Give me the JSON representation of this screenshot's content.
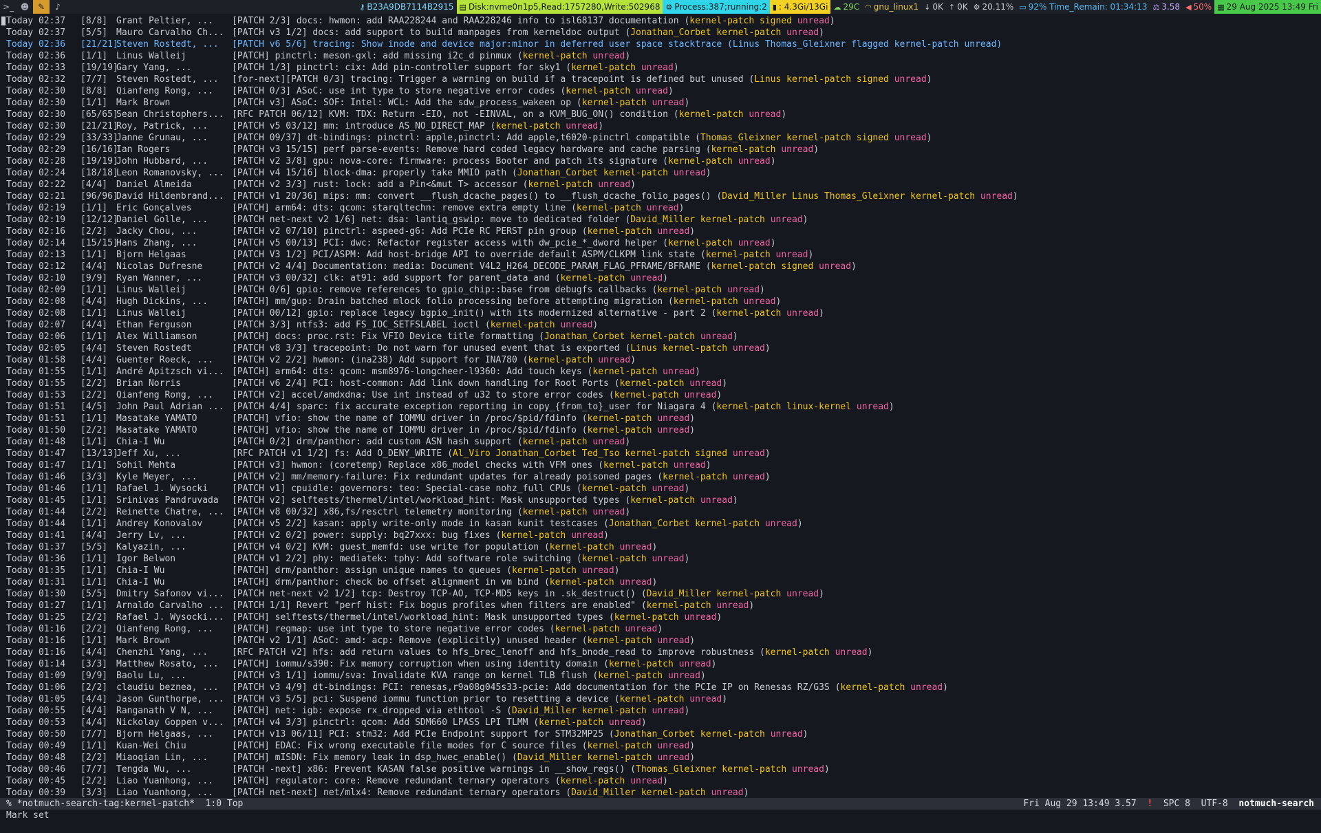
{
  "topbar": {
    "workspaces": [
      ">_",
      "☻",
      "✎",
      "♪"
    ],
    "ip": "B23A9DB7114B2915",
    "disk": "Disk:nvme0n1p5,Read:1757280,Write:502968",
    "process": "Process:387;running:2",
    "mem": ": 4.3Gi/13Gi",
    "temp": "29C",
    "wifi": "gnu_linux1",
    "down": "0K",
    "up": "0K",
    "cpu": "20.11%",
    "battery": "92%",
    "time_remain": "Time_Remain: 01:34:13",
    "load": "3.58",
    "volume": "50%",
    "date": "29 Aug 2025 13:49 Fri",
    "colors": {
      "disk": "#b5e33a",
      "process": "#2fd5e8",
      "mem": "#f2d024",
      "date": "#49c94a"
    }
  },
  "threads": [
    {
      "date": "Today 02:37",
      "count": "[8/8]",
      "author": "Grant Peltier, ...",
      "subject": "[PATCH 2/3] docs: hwmon: add RAA228244 and RAA228246 info to isl68137 documentation",
      "tags": "kernel-patch signed"
    },
    {
      "date": "Today 02:37",
      "count": "[5/5]",
      "author": "Mauro Carvalho Ch...",
      "subject": "[PATCH v3 1/2] docs: add support to build manpages from kerneldoc output",
      "tags": "Jonathan_Corbet kernel-patch"
    },
    {
      "date": "Today 02:36",
      "count": "[21/21]",
      "author": "Steven Rostedt, ...",
      "subject": "[PATCH v6 5/6] tracing: Show inode and device major:minor in deferred user space stacktrace",
      "tags": "Linus Thomas_Gleixner flagged kernel-patch",
      "selected": true
    },
    {
      "date": "Today 02:36",
      "count": "[1/1]",
      "author": "Linus Walleij",
      "subject": "[PATCH] pinctrl: meson-gxl: add missing i2c_d pinmux",
      "tags": "kernel-patch"
    },
    {
      "date": "Today 02:33",
      "count": "[19/19]",
      "author": "Gary Yang, ...",
      "subject": "[PATCH 1/3] pinctrl: cix: Add pin-controller support for sky1",
      "tags": "kernel-patch"
    },
    {
      "date": "Today 02:32",
      "count": "[7/7]",
      "author": "Steven Rostedt, ...",
      "subject": "[for-next][PATCH 0/3] tracing: Trigger a warning on build if a tracepoint is defined but unused",
      "tags": "Linus kernel-patch signed"
    },
    {
      "date": "Today 02:30",
      "count": "[8/8]",
      "author": "Qianfeng Rong, ...",
      "subject": "[PATCH 0/3] ASoC: use int type to store negative error codes",
      "tags": "kernel-patch"
    },
    {
      "date": "Today 02:30",
      "count": "[1/1]",
      "author": "Mark Brown",
      "subject": "[PATCH v3] ASoC: SOF: Intel: WCL: Add the sdw_process_wakeen op",
      "tags": "kernel-patch"
    },
    {
      "date": "Today 02:30",
      "count": "[65/65]",
      "author": "Sean Christophers...",
      "subject": "[RFC PATCH 06/12] KVM: TDX: Return -EIO, not -EINVAL, on a KVM_BUG_ON() condition",
      "tags": "kernel-patch"
    },
    {
      "date": "Today 02:30",
      "count": "[21/21]",
      "author": "Roy, Patrick, ...",
      "subject": "[PATCH v5 03/12] mm: introduce AS_NO_DIRECT_MAP",
      "tags": "kernel-patch"
    },
    {
      "date": "Today 02:29",
      "count": "[33/33]",
      "author": "Janne Grunau, ...",
      "subject": "[PATCH 09/37] dt-bindings: pinctrl: apple,pinctrl: Add apple,t6020-pinctrl compatible",
      "tags": "Thomas_Gleixner kernel-patch signed"
    },
    {
      "date": "Today 02:29",
      "count": "[16/16]",
      "author": "Ian Rogers",
      "subject": "[PATCH v3 15/15] perf parse-events: Remove hard coded legacy hardware and cache parsing",
      "tags": "kernel-patch"
    },
    {
      "date": "Today 02:28",
      "count": "[19/19]",
      "author": "John Hubbard, ...",
      "subject": "[PATCH v2 3/8] gpu: nova-core: firmware: process Booter and patch its signature",
      "tags": "kernel-patch"
    },
    {
      "date": "Today 02:24",
      "count": "[18/18]",
      "author": "Leon Romanovsky, ...",
      "subject": "[PATCH v4 15/16] block-dma: properly take MMIO path",
      "tags": "Jonathan_Corbet kernel-patch"
    },
    {
      "date": "Today 02:22",
      "count": "[4/4]",
      "author": "Daniel Almeida",
      "subject": "[PATCH v2 3/3] rust: lock: add a Pin<&mut T> accessor",
      "tags": "kernel-patch"
    },
    {
      "date": "Today 02:21",
      "count": "[96/96]",
      "author": "David Hildenbrand...",
      "subject": "[PATCH v1 20/36] mips: mm: convert __flush_dcache_pages() to __flush_dcache_folio_pages()",
      "tags": "David_Miller Linus Thomas_Gleixner kernel-patch"
    },
    {
      "date": "Today 02:19",
      "count": "[1/1]",
      "author": "Eric Gonçalves",
      "subject": "[PATCH] arm64: dts: qcom: starqltechn: remove extra empty line",
      "tags": "kernel-patch"
    },
    {
      "date": "Today 02:19",
      "count": "[12/12]",
      "author": "Daniel Golle, ...",
      "subject": "[PATCH net-next v2 1/6] net: dsa: lantiq_gswip: move to dedicated folder",
      "tags": "David_Miller kernel-patch"
    },
    {
      "date": "Today 02:16",
      "count": "[2/2]",
      "author": "Jacky Chou, ...",
      "subject": "[PATCH v2 07/10] pinctrl: aspeed-g6: Add PCIe RC PERST pin group",
      "tags": "kernel-patch"
    },
    {
      "date": "Today 02:14",
      "count": "[15/15]",
      "author": "Hans Zhang, ...",
      "subject": "[PATCH v5 00/13] PCI: dwc: Refactor register access with dw_pcie_*_dword helper",
      "tags": "kernel-patch"
    },
    {
      "date": "Today 02:13",
      "count": "[1/1]",
      "author": "Bjorn Helgaas",
      "subject": "[PATCH V3 1/2] PCI/ASPM: Add host-bridge API to override default ASPM/CLKPM link state",
      "tags": "kernel-patch"
    },
    {
      "date": "Today 02:12",
      "count": "[4/4]",
      "author": "Nicolas Dufresne",
      "subject": "[PATCH v2 4/4] Documentation: media: Document V4L2_H264_DECODE_PARAM_FLAG_PFRAME/BFRAME",
      "tags": "kernel-patch signed"
    },
    {
      "date": "Today 02:10",
      "count": "[9/9]",
      "author": "Ryan Wanner, ...",
      "subject": "[PATCH v3 00/32] clk: at91: add support for parent_data and",
      "tags": "kernel-patch"
    },
    {
      "date": "Today 02:09",
      "count": "[1/1]",
      "author": "Linus Walleij",
      "subject": "[PATCH 0/6] gpio: remove references to gpio_chip::base from debugfs callbacks",
      "tags": "kernel-patch"
    },
    {
      "date": "Today 02:08",
      "count": "[4/4]",
      "author": "Hugh Dickins, ...",
      "subject": "[PATCH] mm/gup: Drain batched mlock folio processing before attempting migration",
      "tags": "kernel-patch"
    },
    {
      "date": "Today 02:08",
      "count": "[1/1]",
      "author": "Linus Walleij",
      "subject": "[PATCH 00/12] gpio: replace legacy bgpio_init() with its modernized alternative - part 2",
      "tags": "kernel-patch"
    },
    {
      "date": "Today 02:07",
      "count": "[4/4]",
      "author": "Ethan Ferguson",
      "subject": "[PATCH 3/3] ntfs3: add FS_IOC_SETFSLABEL ioctl",
      "tags": "kernel-patch"
    },
    {
      "date": "Today 02:06",
      "count": "[1/1]",
      "author": "Alex Williamson",
      "subject": "[PATCH] docs: proc.rst: Fix VFIO Device title formatting",
      "tags": "Jonathan_Corbet kernel-patch"
    },
    {
      "date": "Today 02:05",
      "count": "[4/4]",
      "author": "Steven Rostedt",
      "subject": "[PATCH v8 3/3] tracepoint: Do not warn for unused event that is exported",
      "tags": "Linus kernel-patch"
    },
    {
      "date": "Today 01:58",
      "count": "[4/4]",
      "author": "Guenter Roeck, ...",
      "subject": "[PATCH v2 2/2] hwmon: (ina238) Add support for INA780",
      "tags": "kernel-patch"
    },
    {
      "date": "Today 01:55",
      "count": "[1/1]",
      "author": "André Apitzsch vi...",
      "subject": "[PATCH] arm64: dts: qcom: msm8976-longcheer-l9360: Add touch keys",
      "tags": "kernel-patch"
    },
    {
      "date": "Today 01:55",
      "count": "[2/2]",
      "author": "Brian Norris",
      "subject": "[PATCH v6 2/4] PCI: host-common: Add link down handling for Root Ports",
      "tags": "kernel-patch"
    },
    {
      "date": "Today 01:53",
      "count": "[2/2]",
      "author": "Qianfeng Rong, ...",
      "subject": "[PATCH v2] accel/amdxdna: Use int instead of u32 to store error codes",
      "tags": "kernel-patch"
    },
    {
      "date": "Today 01:51",
      "count": "[4/5]",
      "author": "John Paul Adrian ...",
      "subject": "[PATCH 4/4] sparc: fix accurate exception reporting in copy_{from_to}_user for Niagara 4",
      "tags": "kernel-patch linux-kernel"
    },
    {
      "date": "Today 01:51",
      "count": "[1/1]",
      "author": "Masatake YAMATO",
      "subject": "[PATCH] vfio: show the name of IOMMU driver in /proc/$pid/fdinfo",
      "tags": "kernel-patch"
    },
    {
      "date": "Today 01:50",
      "count": "[2/2]",
      "author": "Masatake YAMATO",
      "subject": "[PATCH] vfio: show the name of IOMMU driver in /proc/$pid/fdinfo",
      "tags": "kernel-patch"
    },
    {
      "date": "Today 01:48",
      "count": "[1/1]",
      "author": "Chia-I Wu",
      "subject": "[PATCH 0/2] drm/panthor: add custom ASN hash support",
      "tags": "kernel-patch"
    },
    {
      "date": "Today 01:47",
      "count": "[13/13]",
      "author": "Jeff Xu, ...",
      "subject": "[RFC PATCH v1 1/2] fs: Add O_DENY_WRITE",
      "tags": "Al_Viro Jonathan_Corbet Ted_Tso kernel-patch signed"
    },
    {
      "date": "Today 01:47",
      "count": "[1/1]",
      "author": "Sohil Mehta",
      "subject": "[PATCH v3] hwmon: (coretemp) Replace x86_model checks with VFM ones",
      "tags": "kernel-patch"
    },
    {
      "date": "Today 01:46",
      "count": "[3/3]",
      "author": "Kyle Meyer, ...",
      "subject": "[PATCH v2] mm/memory-failure: Fix redundant updates for already poisoned pages",
      "tags": "kernel-patch"
    },
    {
      "date": "Today 01:46",
      "count": "[1/1]",
      "author": "Rafael J. Wysocki",
      "subject": "[PATCH v1] cpuidle: governors: teo: Special-case nohz_full CPUs",
      "tags": "kernel-patch"
    },
    {
      "date": "Today 01:45",
      "count": "[1/1]",
      "author": "Srinivas Pandruvada",
      "subject": "[PATCH v2] selftests/thermel/intel/workload_hint: Mask unsupported types",
      "tags": "kernel-patch"
    },
    {
      "date": "Today 01:44",
      "count": "[2/2]",
      "author": "Reinette Chatre, ...",
      "subject": "[PATCH v8 00/32] x86,fs/resctrl telemetry monitoring",
      "tags": "kernel-patch"
    },
    {
      "date": "Today 01:44",
      "count": "[1/1]",
      "author": "Andrey Konovalov",
      "subject": "[PATCH v5 2/2] kasan: apply write-only mode in kasan kunit testcases",
      "tags": "Jonathan_Corbet kernel-patch"
    },
    {
      "date": "Today 01:41",
      "count": "[4/4]",
      "author": "Jerry Lv, ...",
      "subject": "[PATCH v2 0/2] power: supply: bq27xxx: bug fixes",
      "tags": "kernel-patch"
    },
    {
      "date": "Today 01:37",
      "count": "[5/5]",
      "author": "Kalyazin, ...",
      "subject": "[PATCH v4 0/2] KVM: guest_memfd: use write for population",
      "tags": "kernel-patch"
    },
    {
      "date": "Today 01:36",
      "count": "[1/1]",
      "author": "Igor Belwon",
      "subject": "[PATCH v1 2/2] phy: mediatek: tphy: Add software role switching",
      "tags": "kernel-patch"
    },
    {
      "date": "Today 01:35",
      "count": "[1/1]",
      "author": "Chia-I Wu",
      "subject": "[PATCH] drm/panthor: assign unique names to queues",
      "tags": "kernel-patch"
    },
    {
      "date": "Today 01:31",
      "count": "[1/1]",
      "author": "Chia-I Wu",
      "subject": "[PATCH] drm/panthor: check bo offset alignment in vm bind",
      "tags": "kernel-patch"
    },
    {
      "date": "Today 01:30",
      "count": "[5/5]",
      "author": "Dmitry Safonov vi...",
      "subject": "[PATCH net-next v2 1/2] tcp: Destroy TCP-AO, TCP-MD5 keys in .sk_destruct()",
      "tags": "David_Miller kernel-patch"
    },
    {
      "date": "Today 01:27",
      "count": "[1/1]",
      "author": "Arnaldo Carvalho ...",
      "subject": "[PATCH 1/1] Revert \"perf hist: Fix bogus profiles when filters are enabled\"",
      "tags": "kernel-patch"
    },
    {
      "date": "Today 01:25",
      "count": "[2/2]",
      "author": "Rafael J. Wysocki...",
      "subject": "[PATCH] selftests/thermel/intel/workload_hint: Mask unsupported types",
      "tags": "kernel-patch"
    },
    {
      "date": "Today 01:16",
      "count": "[2/2]",
      "author": "Qianfeng Rong, ...",
      "subject": "[PATCH] regmap: use int type to store negative error codes",
      "tags": "kernel-patch"
    },
    {
      "date": "Today 01:16",
      "count": "[1/1]",
      "author": "Mark Brown",
      "subject": "[PATCH v2 1/1] ASoC: amd: acp: Remove (explicitly) unused header",
      "tags": "kernel-patch"
    },
    {
      "date": "Today 01:16",
      "count": "[4/4]",
      "author": "Chenzhi Yang, ...",
      "subject": "[RFC PATCH v2] hfs: add return values to hfs_brec_lenoff and hfs_bnode_read to improve robustness",
      "tags": "kernel-patch"
    },
    {
      "date": "Today 01:14",
      "count": "[3/3]",
      "author": "Matthew Rosato, ...",
      "subject": "[PATCH] iommu/s390: Fix memory corruption when using identity domain",
      "tags": "kernel-patch"
    },
    {
      "date": "Today 01:09",
      "count": "[9/9]",
      "author": "Baolu Lu, ...",
      "subject": "[PATCH v3 1/1] iommu/sva: Invalidate KVA range on kernel TLB flush",
      "tags": "kernel-patch"
    },
    {
      "date": "Today 01:06",
      "count": "[2/2]",
      "author": "claudiu beznea, ...",
      "subject": "[PATCH v3 4/9] dt-bindings: PCI: renesas,r9a08g045s33-pcie: Add documentation for the PCIe IP on Renesas RZ/G3S",
      "tags": "kernel-patch"
    },
    {
      "date": "Today 01:05",
      "count": "[4/4]",
      "author": "Jason Gunthorpe, ...",
      "subject": "[PATCH v3 5/5] pci: Suspend iommu function prior to resetting a device",
      "tags": "kernel-patch"
    },
    {
      "date": "Today 00:55",
      "count": "[4/4]",
      "author": "Ranganath V N, ...",
      "subject": "[PATCH] net: igb: expose rx_dropped via ethtool -S",
      "tags": "David_Miller kernel-patch"
    },
    {
      "date": "Today 00:53",
      "count": "[4/4]",
      "author": "Nickolay Goppen v...",
      "subject": "[PATCH v4 3/3] pinctrl: qcom: Add SDM660 LPASS LPI TLMM",
      "tags": "kernel-patch"
    },
    {
      "date": "Today 00:50",
      "count": "[7/7]",
      "author": "Bjorn Helgaas, ...",
      "subject": "[PATCH v13 06/11] PCI: stm32: Add PCIe Endpoint support for STM32MP25",
      "tags": "Jonathan_Corbet kernel-patch"
    },
    {
      "date": "Today 00:49",
      "count": "[1/1]",
      "author": "Kuan-Wei Chiu",
      "subject": "[PATCH] EDAC: Fix wrong executable file modes for C source files",
      "tags": "kernel-patch"
    },
    {
      "date": "Today 00:48",
      "count": "[2/2]",
      "author": "Miaoqian Lin, ...",
      "subject": "[PATCH] mISDN: Fix memory leak in dsp_hwec_enable()",
      "tags": "David_Miller kernel-patch"
    },
    {
      "date": "Today 00:46",
      "count": "[7/7]",
      "author": "Tengda Wu, ...",
      "subject": "[PATCH -next] x86: Prevent KASAN false positive warnings in __show_regs()",
      "tags": "Thomas_Gleixner kernel-patch"
    },
    {
      "date": "Today 00:45",
      "count": "[2/2]",
      "author": "Liao Yuanhong, ...",
      "subject": "[PATCH] regulator: core: Remove redundant ternary operators",
      "tags": "kernel-patch"
    },
    {
      "date": "Today 00:39",
      "count": "[3/3]",
      "author": "Liao Yuanhong, ...",
      "subject": "[PATCH net-next] net/mlx4: Remove redundant ternary operators",
      "tags": "David_Miller kernel-patch"
    }
  ],
  "unread_label": "unread",
  "modeline": {
    "buffer": "% *notmuch-search-tag:kernel-patch*",
    "position": "1:0 Top",
    "datetime": "Fri Aug 29 13:49 3.57",
    "warning": "!",
    "indent": "SPC 8",
    "encoding": "UTF-8",
    "mode": "notmuch-search"
  },
  "echo": "Mark set"
}
